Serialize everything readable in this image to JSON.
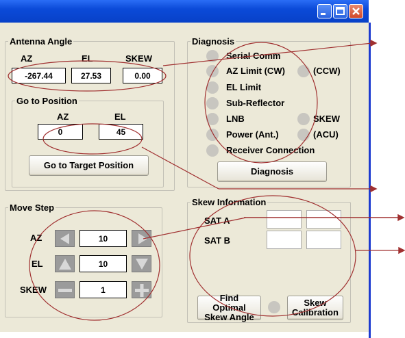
{
  "antenna_angle": {
    "title": "Antenna Angle",
    "az_label": "AZ",
    "el_label": "EL",
    "skew_label": "SKEW",
    "az_value": "-267.44",
    "el_value": "27.53",
    "skew_value": "0.00"
  },
  "goto": {
    "title": "Go to Position",
    "az_label": "AZ",
    "el_label": "EL",
    "az_value": "0",
    "el_value": "45",
    "button_label": "Go to Target Position"
  },
  "move_step": {
    "title": "Move Step",
    "az_label": "AZ",
    "el_label": "EL",
    "skew_label": "SKEW",
    "az_value": "10",
    "el_value": "10",
    "skew_value": "1"
  },
  "diagnosis": {
    "title": "Diagnosis",
    "items": {
      "serial_comm": "Serial Comm",
      "az_limit_cw": "AZ Limit (CW)",
      "az_limit_ccw": "(CCW)",
      "el_limit": "EL Limit",
      "sub_reflector": "Sub-Reflector",
      "lnb": "LNB",
      "skew": "SKEW",
      "power_ant": "Power (Ant.)",
      "power_acu": "(ACU)",
      "receiver": "Receiver Connection"
    },
    "button_label": "Diagnosis"
  },
  "skew_info": {
    "title": "Skew Information",
    "sat_a_label": "SAT A",
    "sat_b_label": "SAT B",
    "find_button_label": "Find Optimal Skew Angle",
    "calibration_button_label": "Skew Calibration"
  },
  "colors": {
    "titlebar": "#0b4ad8",
    "window_bg": "#ece9d8",
    "indicator_off": "#c8c6c0",
    "annotation": "#a03030",
    "step_button": "#9b9b9b"
  }
}
